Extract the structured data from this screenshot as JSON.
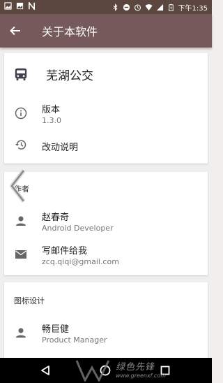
{
  "status_bar": {
    "time": "下午1:35"
  },
  "app_bar": {
    "title": "关于本软件"
  },
  "about_card": {
    "app_name": "芜湖公交",
    "version_label": "版本",
    "version_value": "1.3.0",
    "changelog_label": "改动说明"
  },
  "author_card": {
    "section_title": "作者",
    "author_name": "赵春奇",
    "author_role": "Android Developer",
    "email_label": "写邮件给我",
    "email_value": "zcq.qiqi@gmail.com"
  },
  "icon_design_card": {
    "section_title": "图标设计",
    "designer_name": "畅巨健",
    "designer_role": "Product Manager"
  },
  "watermark": {
    "text": "绿色先锋",
    "url": "www.greenxf.com"
  },
  "colors": {
    "app_bar": "#76595a",
    "status_bar": "#5b4640",
    "background": "#f1efed"
  }
}
